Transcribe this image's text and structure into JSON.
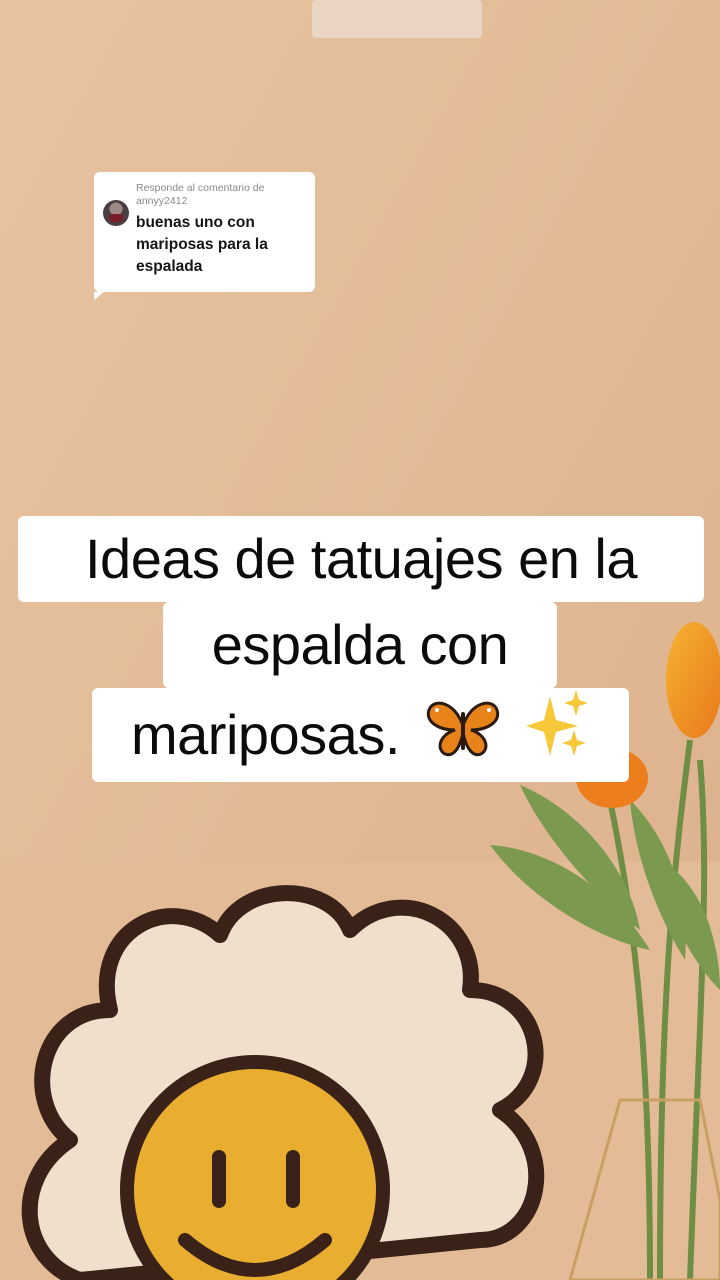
{
  "reply_card": {
    "label": "Responde al comentario de annyy2412",
    "comment": "buenas uno con mariposas para la espalada"
  },
  "caption": {
    "line1": "Ideas de tatuajes en la",
    "line2": "espalda con",
    "line3": "mariposas.",
    "emojis": [
      "butterfly-icon",
      "sparkles-icon"
    ]
  },
  "colors": {
    "wall": "#E5C09C",
    "flower_outline": "#3A2218",
    "smiley_face": "#E9AE30",
    "tulip_orange": "#F08A1E",
    "stem_green": "#6E8E45"
  }
}
